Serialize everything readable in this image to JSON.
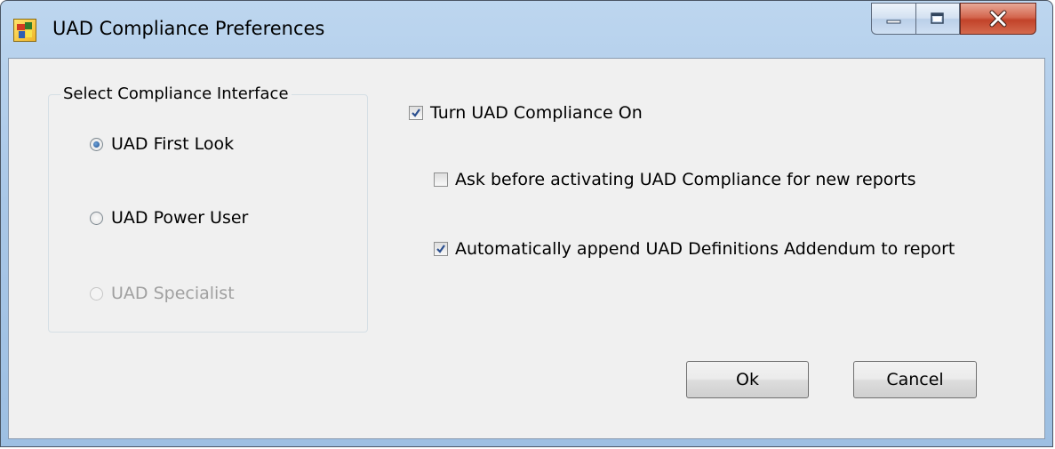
{
  "window": {
    "title": "UAD Compliance Preferences",
    "icon": "app-icon"
  },
  "caption_buttons": {
    "minimize_icon": "minimize-icon",
    "maximize_icon": "maximize-icon",
    "close_icon": "close-icon"
  },
  "interface_group": {
    "legend": "Select Compliance Interface",
    "options": [
      {
        "label": "UAD First Look",
        "selected": true,
        "enabled": true
      },
      {
        "label": "UAD Power User",
        "selected": false,
        "enabled": true
      },
      {
        "label": "UAD Specialist",
        "selected": false,
        "enabled": false
      }
    ]
  },
  "options": {
    "turn_on": {
      "label": "Turn UAD Compliance On",
      "checked": true
    },
    "ask_before": {
      "label": "Ask before activating UAD Compliance for new reports",
      "checked": false
    },
    "auto_append": {
      "label": "Automatically append UAD Definitions Addendum to report",
      "checked": true
    }
  },
  "buttons": {
    "ok_label": "Ok",
    "cancel_label": "Cancel"
  },
  "colors": {
    "title_bar": "#a9c7e7",
    "close_button": "#c2432a",
    "dialog_bg": "#f0f0f0",
    "radio_dot": "#1e4f8f",
    "checkmark": "#2b4f8f"
  }
}
